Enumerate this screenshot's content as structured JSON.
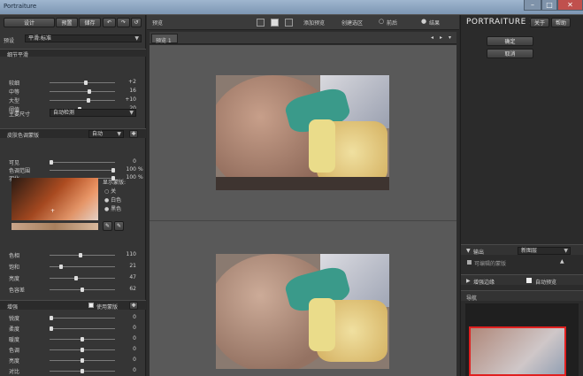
{
  "window": {
    "title": "Portraiture",
    "minimize_icon": "minimize-icon",
    "maximize_icon": "maximize-icon",
    "close_icon": "close-icon"
  },
  "left": {
    "top_buttons": [
      "设计",
      "预置",
      "储存"
    ],
    "preset_label": "预设",
    "preset_value": "平滑:标准",
    "detail_section": {
      "title": "细节平滑",
      "sliders": [
        {
          "label": "较细",
          "value": "+2",
          "level": 0.55
        },
        {
          "label": "中等",
          "value": "16",
          "level": 0.62
        },
        {
          "label": "大型",
          "value": "+10",
          "level": 0.6
        },
        {
          "label": "阈值",
          "value": "20",
          "level": 0.45
        }
      ],
      "size_label": "主要尺寸",
      "size_value": "自动检测"
    },
    "mask_section": {
      "title": "皮肤色调蒙版",
      "mode": "自动",
      "sliders": [
        {
          "label": "可见",
          "value": "0",
          "level": 0.0
        },
        {
          "label": "色调范围",
          "value": "100",
          "unit": "%",
          "level": 1.0
        },
        {
          "label": "羽化",
          "value": "100",
          "unit": "%",
          "level": 1.0
        }
      ],
      "display_label": "显示蒙版:",
      "options": [
        "关",
        "白色",
        "黑色"
      ],
      "selected_option": "关",
      "sliders2": [
        {
          "label": "色相",
          "value": "110",
          "level": 0.47
        },
        {
          "label": "饱和",
          "value": "21",
          "level": 0.15
        },
        {
          "label": "亮度",
          "value": "47",
          "level": 0.4
        },
        {
          "label": "色容差",
          "value": "62",
          "level": 0.5
        }
      ]
    },
    "enhance_section": {
      "title": "增强",
      "checkbox_label": "使用蒙版",
      "sliders": [
        {
          "label": "锐度",
          "value": "0",
          "level": 0.0
        },
        {
          "label": "柔度",
          "value": "0",
          "level": 0.0
        },
        {
          "label": "暖度",
          "value": "0",
          "level": 0.5
        },
        {
          "label": "色调",
          "value": "0",
          "level": 0.5
        },
        {
          "label": "亮度",
          "value": "0",
          "level": 0.5
        },
        {
          "label": "对比",
          "value": "0",
          "level": 0.5
        }
      ]
    }
  },
  "center": {
    "toolbar_title": "预览",
    "toolbar_items": [
      "添加预览",
      "创建选区"
    ],
    "radio_before": "前后",
    "radio_after": "结果",
    "tab_label": "预览 1"
  },
  "right": {
    "brand": "PORTRAITURE 2",
    "about": "关于",
    "help": "帮助",
    "ok": "确定",
    "cancel": "取消",
    "output_label": "输出",
    "output_value": "新图层",
    "output_check_label": "可编辑的蒙版",
    "edge_label": "增强边缘",
    "auto_label": "自动预览",
    "navigator_label": "导航"
  }
}
